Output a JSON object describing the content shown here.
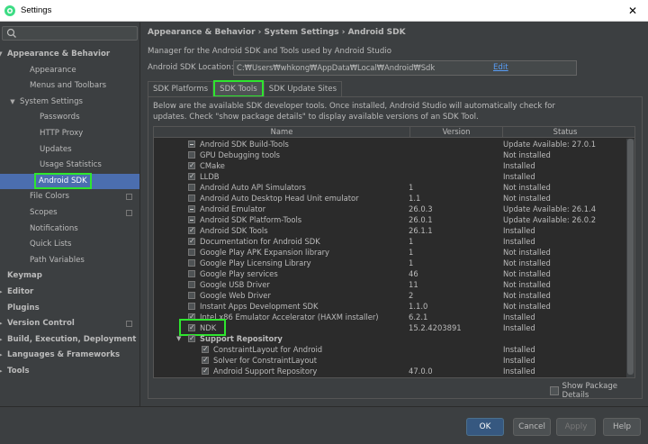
{
  "window": {
    "title": "Settings"
  },
  "search": {
    "placeholder": ""
  },
  "sidebar": {
    "items": [
      {
        "label": "Appearance & Behavior",
        "level": 0,
        "arrow": "▼",
        "bold": true
      },
      {
        "label": "Appearance",
        "level": 2
      },
      {
        "label": "Menus and Toolbars",
        "level": 2
      },
      {
        "label": "System Settings",
        "level": 1,
        "arrow": "▼"
      },
      {
        "label": "Passwords",
        "level": 3
      },
      {
        "label": "HTTP Proxy",
        "level": 3
      },
      {
        "label": "Updates",
        "level": 3
      },
      {
        "label": "Usage Statistics",
        "level": 3
      },
      {
        "label": "Android SDK",
        "level": 3,
        "selected": true
      },
      {
        "label": "File Colors",
        "level": 2,
        "proj": true
      },
      {
        "label": "Scopes",
        "level": 2,
        "proj": true
      },
      {
        "label": "Notifications",
        "level": 2
      },
      {
        "label": "Quick Lists",
        "level": 2
      },
      {
        "label": "Path Variables",
        "level": 2
      },
      {
        "label": "Keymap",
        "level": 0,
        "bold": true
      },
      {
        "label": "Editor",
        "level": 0,
        "arrow": "▶",
        "bold": true
      },
      {
        "label": "Plugins",
        "level": 0,
        "bold": true
      },
      {
        "label": "Version Control",
        "level": 0,
        "arrow": "▶",
        "bold": true,
        "proj": true
      },
      {
        "label": "Build, Execution, Deployment",
        "level": 0,
        "arrow": "▶",
        "bold": true
      },
      {
        "label": "Languages & Frameworks",
        "level": 0,
        "arrow": "▶",
        "bold": true
      },
      {
        "label": "Tools",
        "level": 0,
        "arrow": "▶",
        "bold": true
      }
    ]
  },
  "main": {
    "breadcrumb": "Appearance & Behavior › System Settings › Android SDK",
    "description": "Manager for the Android SDK and Tools used by Android Studio",
    "location_label": "Android SDK Location:",
    "location_value": "C:₩Users₩whkong₩AppData₩Local₩Android₩Sdk",
    "edit_label": "Edit",
    "tabs": [
      {
        "label": "SDK Platforms",
        "active": false
      },
      {
        "label": "SDK Tools",
        "active": true
      },
      {
        "label": "SDK Update Sites",
        "active": false
      }
    ],
    "info_line1": "Below are the available SDK developer tools. Once installed, Android Studio will automatically check for",
    "info_line2": "updates. Check \"show package details\" to display available versions of an SDK Tool.",
    "table": {
      "headers": {
        "name": "Name",
        "version": "Version",
        "status": "Status"
      },
      "rows": [
        {
          "name": "Android SDK Build-Tools",
          "version": "",
          "status": "Update Available: 27.0.1",
          "check": "partial",
          "indent": 0
        },
        {
          "name": "GPU Debugging tools",
          "version": "",
          "status": "Not installed",
          "check": "none",
          "indent": 0
        },
        {
          "name": "CMake",
          "version": "",
          "status": "Installed",
          "check": "checked",
          "indent": 0
        },
        {
          "name": "LLDB",
          "version": "",
          "status": "Installed",
          "check": "checked",
          "indent": 0
        },
        {
          "name": "Android Auto API Simulators",
          "version": "1",
          "status": "Not installed",
          "check": "none",
          "indent": 0
        },
        {
          "name": "Android Auto Desktop Head Unit emulator",
          "version": "1.1",
          "status": "Not installed",
          "check": "none",
          "indent": 0
        },
        {
          "name": "Android Emulator",
          "version": "26.0.3",
          "status": "Update Available: 26.1.4",
          "check": "partial",
          "indent": 0
        },
        {
          "name": "Android SDK Platform-Tools",
          "version": "26.0.1",
          "status": "Update Available: 26.0.2",
          "check": "partial",
          "indent": 0
        },
        {
          "name": "Android SDK Tools",
          "version": "26.1.1",
          "status": "Installed",
          "check": "checked",
          "indent": 0
        },
        {
          "name": "Documentation for Android SDK",
          "version": "1",
          "status": "Installed",
          "check": "checked",
          "indent": 0
        },
        {
          "name": "Google Play APK Expansion library",
          "version": "1",
          "status": "Not installed",
          "check": "none",
          "indent": 0
        },
        {
          "name": "Google Play Licensing Library",
          "version": "1",
          "status": "Not installed",
          "check": "none",
          "indent": 0
        },
        {
          "name": "Google Play services",
          "version": "46",
          "status": "Not installed",
          "check": "none",
          "indent": 0
        },
        {
          "name": "Google USB Driver",
          "version": "11",
          "status": "Not installed",
          "check": "none",
          "indent": 0
        },
        {
          "name": "Google Web Driver",
          "version": "2",
          "status": "Not installed",
          "check": "none",
          "indent": 0
        },
        {
          "name": "Instant Apps Development SDK",
          "version": "1.1.0",
          "status": "Not installed",
          "check": "none",
          "indent": 0
        },
        {
          "name": "Intel x86 Emulator Accelerator (HAXM installer)",
          "version": "6.2.1",
          "status": "Installed",
          "check": "checked",
          "indent": 0
        },
        {
          "name": "NDK",
          "version": "15.2.4203891",
          "status": "Installed",
          "check": "checked",
          "indent": 0,
          "highlight": true
        },
        {
          "name": "Support Repository",
          "version": "",
          "status": "",
          "check": "checked",
          "indent": 0,
          "group": true,
          "arrow": "▼"
        },
        {
          "name": "ConstraintLayout for Android",
          "version": "",
          "status": "Installed",
          "check": "checked",
          "indent": 1
        },
        {
          "name": "Solver for ConstraintLayout",
          "version": "",
          "status": "Installed",
          "check": "checked",
          "indent": 1
        },
        {
          "name": "Android Support Repository",
          "version": "47.0.0",
          "status": "Installed",
          "check": "checked",
          "indent": 1
        }
      ]
    },
    "show_details_label": "Show Package Details"
  },
  "footer": {
    "ok": "OK",
    "cancel": "Cancel",
    "apply": "Apply",
    "help": "Help"
  }
}
